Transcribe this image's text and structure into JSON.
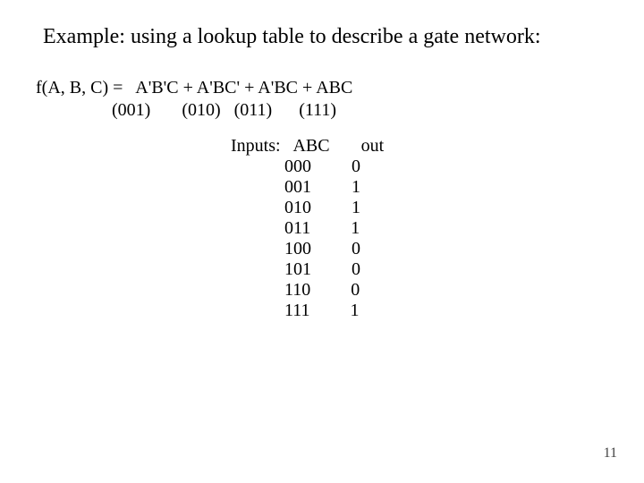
{
  "title": "Example:  using a lookup table to describe a gate network:",
  "equation": {
    "line1": "f(A, B, C) =   A'B'C + A'BC' + A'BC + ABC",
    "line2": "                 (001)       (010)   (011)      (111)"
  },
  "table": {
    "header_label": "Inputs:",
    "col_inputs": "ABC",
    "col_out": "out",
    "rows": [
      {
        "abc": "000",
        "out": "0"
      },
      {
        "abc": "001",
        "out": "1"
      },
      {
        "abc": "010",
        "out": "1"
      },
      {
        "abc": "011",
        "out": "1"
      },
      {
        "abc": "100",
        "out": "0"
      },
      {
        "abc": "101",
        "out": "0"
      },
      {
        "abc": "110",
        "out": "0"
      },
      {
        "abc": "111",
        "out": "1"
      }
    ]
  },
  "page_number": "11"
}
